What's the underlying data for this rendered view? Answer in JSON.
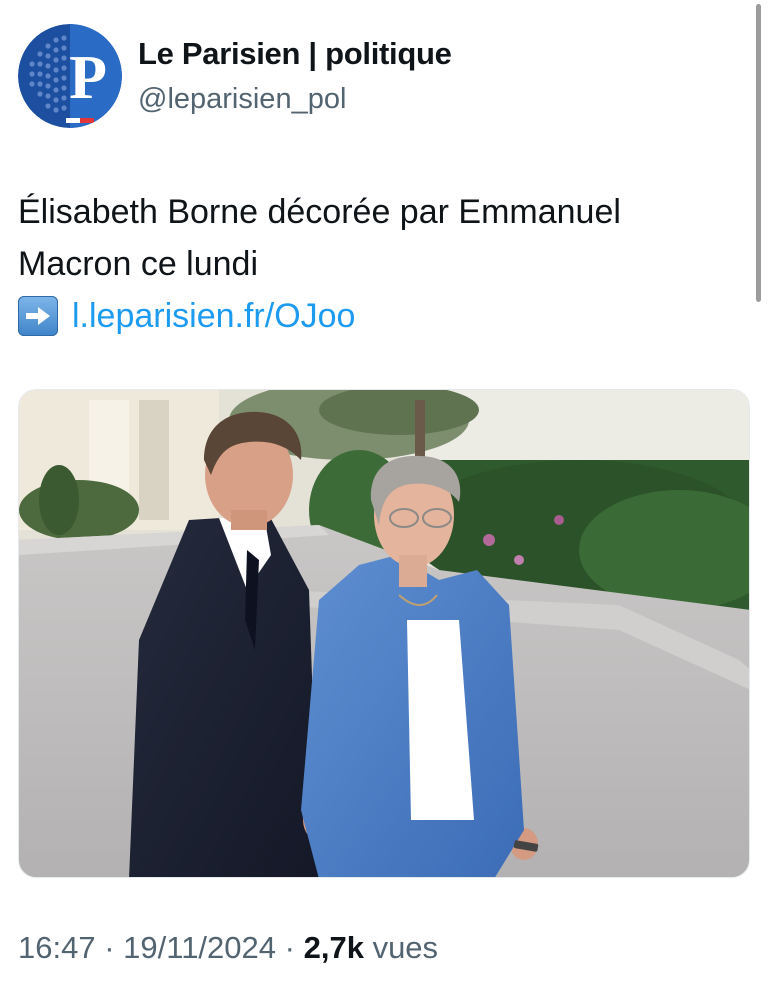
{
  "author": {
    "display_name": "Le Parisien | politique",
    "handle": "@leparisien_pol",
    "avatar_icon": "le-parisien-logo",
    "avatar_letter": "P",
    "brand_color": "#123a8c"
  },
  "tweet": {
    "text_line_1": "Élisabeth Borne décorée par Emmanuel",
    "text_line_2": "Macron ce lundi",
    "link_icon": "right-arrow-emoji",
    "link_text": "l.leparisien.fr/OJoo",
    "link_color": "#1d9bf0"
  },
  "media": {
    "type": "photo"
  },
  "meta": {
    "time": "16:47",
    "date": "19/11/2024",
    "separator": "·",
    "view_count": "2,7k",
    "view_label": "vues"
  }
}
